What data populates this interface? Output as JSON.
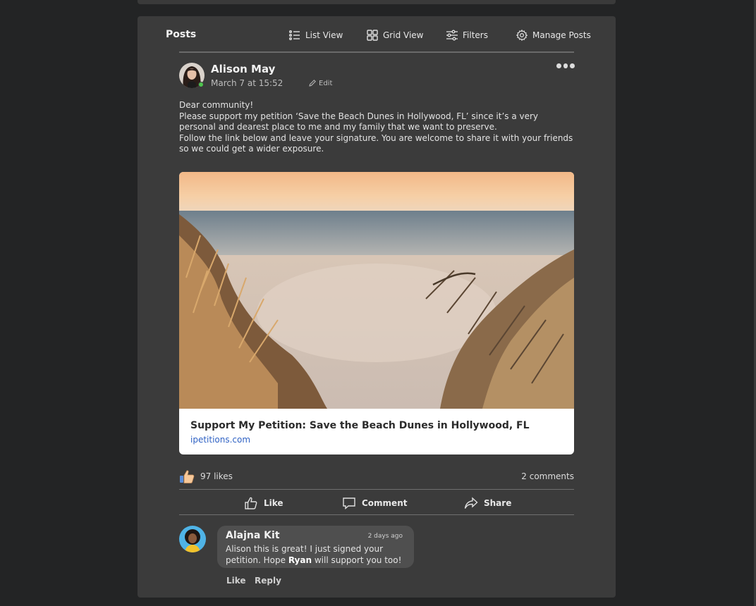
{
  "toolbar": {
    "title": "Posts",
    "list_view": "List View",
    "grid_view": "Grid View",
    "filters": "Filters",
    "manage_posts": "Manage Posts"
  },
  "post": {
    "author": "Alison May",
    "date": "March 7 at 15:52",
    "edit_label": "Edit",
    "body": [
      "Dear community!",
      "Please support my petition ‘Save the Beach Dunes in Hollywood, FL’ since it’s a very personal and dearest place to me and my family that we want to preserve.",
      "Follow the link below and leave your signature. You are welcome to share it with your friends so we could get a wider exposure."
    ],
    "link": {
      "title": "Support My Petition: Save the Beach Dunes in Hollywood, FL",
      "domain": "ipetitions.com"
    },
    "likes": "97 likes",
    "comments": "2 comments",
    "actions": {
      "like": "Like",
      "comment": "Comment",
      "share": "Share"
    }
  },
  "comment": {
    "author": "Alajna Kit",
    "time": "2 days ago",
    "text_before": "Alison this is great! I just signed your petition. Hope ",
    "mention": "Ryan",
    "text_after": " will support you too!",
    "like": "Like",
    "reply": "Reply"
  },
  "colors": {
    "page_bg": "#232425",
    "card_bg": "#3b3b3b",
    "online": "#4ec44e",
    "link": "#2f62c4",
    "like_blue": "#5b8dd9",
    "like_thumb": "#f6c89a"
  },
  "icons": {
    "list_view": "list-icon",
    "grid_view": "grid-icon",
    "filters": "sliders-icon",
    "manage": "gear-icon",
    "edit": "pencil-icon",
    "more": "more-dots-icon",
    "like": "thumbs-up-icon",
    "comment": "comment-icon",
    "share": "share-icon"
  }
}
